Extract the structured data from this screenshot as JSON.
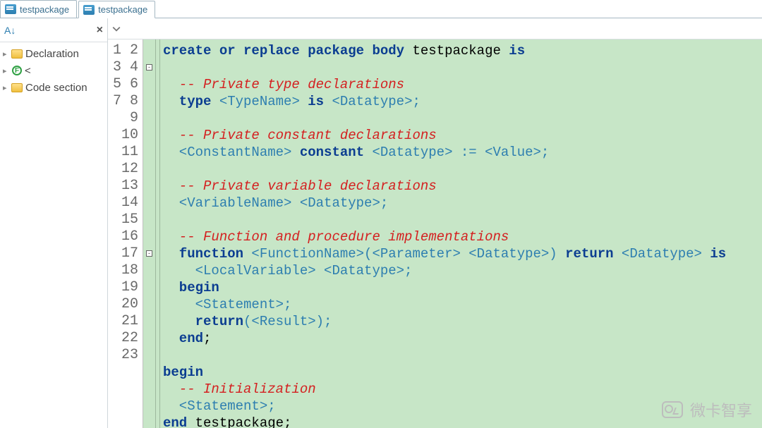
{
  "tabs": [
    {
      "label": "testpackage",
      "active": false
    },
    {
      "label": "testpackage",
      "active": true
    }
  ],
  "sidebar": {
    "items": [
      {
        "label": "Declaration",
        "kind": "folder"
      },
      {
        "label": "<",
        "kind": "func"
      },
      {
        "label": "Code section",
        "kind": "folder"
      }
    ]
  },
  "gutter_lines": [
    "1",
    "2",
    "3",
    "4",
    "5",
    "6",
    "7",
    "8",
    "9",
    "10",
    "11",
    "12",
    "13",
    "14",
    "15",
    "16",
    "17",
    "18",
    "19",
    "20",
    "21",
    "22",
    "23"
  ],
  "code": {
    "l1": {
      "a": "create or replace package body",
      "b": " testpackage ",
      "c": "is"
    },
    "l3": "  -- Private type declarations",
    "l4": {
      "a": "  type",
      "b": " <TypeName> ",
      "c": "is",
      "d": " <Datatype>;"
    },
    "l6": "  -- Private constant declarations",
    "l7": {
      "a": "  <ConstantName> ",
      "b": "constant",
      "c": " <Datatype> := <Value>;"
    },
    "l9": "  -- Private variable declarations",
    "l10": "  <VariableName> <Datatype>;",
    "l12": "  -- Function and procedure implementations",
    "l13": {
      "a": "  function",
      "b": " <FunctionName>(<Parameter> <Datatype>) ",
      "c": "return",
      "d": " <Datatype> ",
      "e": "is"
    },
    "l14": "    <LocalVariable> <Datatype>;",
    "l15": "  begin",
    "l16": "    <Statement>;",
    "l17": {
      "a": "    return",
      "b": "(<Result>);"
    },
    "l18": "  end",
    "l18s": ";",
    "l20": "begin",
    "l21": "  -- Initialization",
    "l22": "  <Statement>;",
    "l23": {
      "a": "end",
      "b": " testpackage;"
    }
  },
  "watermark": "微卡智享",
  "fold_markers": [
    {
      "line": 2,
      "glyph": "-"
    },
    {
      "line": 13,
      "glyph": "-"
    }
  ]
}
